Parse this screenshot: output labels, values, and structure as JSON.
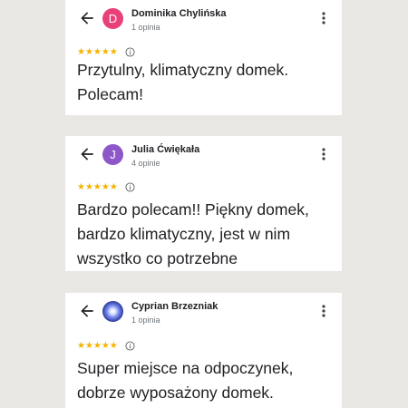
{
  "reviews": [
    {
      "author": "Dominika Chylińska",
      "avatar_letter": "D",
      "avatar_color": "#e8407a",
      "review_count": "1 opinia",
      "rating": 5,
      "stars": "★★★★★",
      "text": "Przytulny, klimatyczny domek. Polecam!"
    },
    {
      "author": "Julia Ćwiękała",
      "avatar_letter": "J",
      "avatar_color": "#8e57c9",
      "review_count": "4 opinie",
      "rating": 5,
      "stars": "★★★★★",
      "text": "Bardzo polecam!! Piękny domek, bardzo klimatyczny, jest w nim wszystko co potrzebne"
    },
    {
      "author": "Cyprian Brzezniak",
      "avatar_letter": "",
      "avatar_color": "photo",
      "review_count": "1 opinia",
      "rating": 5,
      "stars": "★★★★★",
      "text": "Super miejsce na odpoczynek, dobrze wyposażony domek."
    }
  ],
  "icons": {
    "back": "arrow-back-icon",
    "menu": "more-vert-icon",
    "info": "info-icon",
    "star": "star-icon"
  },
  "colors": {
    "background": "#e9e7e4",
    "card": "#ffffff",
    "star": "#f4b400",
    "text": "#202124",
    "secondary_text": "#70757a"
  }
}
